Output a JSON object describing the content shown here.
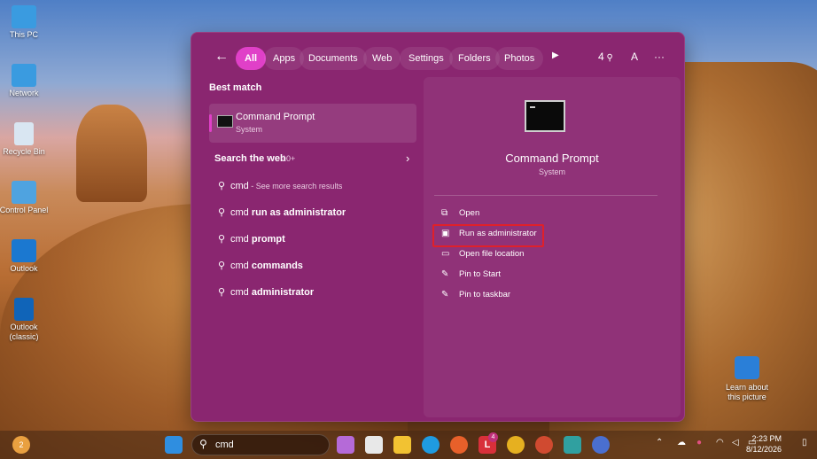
{
  "desktop": {
    "icons": [
      {
        "label": "This PC"
      },
      {
        "label": "Network"
      },
      {
        "label": "Recycle Bin"
      },
      {
        "label": "Control Panel"
      },
      {
        "label": "Outlook"
      },
      {
        "label": "Outlook (classic)"
      }
    ],
    "learn_label": "Learn about this picture"
  },
  "panel": {
    "back_glyph": "←",
    "filters": [
      "All",
      "Apps",
      "Documents",
      "Web",
      "Settings",
      "Folders",
      "Photos"
    ],
    "active_filter": "All",
    "play_glyph": "▶",
    "rewards_count": "4",
    "account_letter": "A",
    "more_glyph": "···",
    "best_match": {
      "section_title": "Best match",
      "title": "Command Prompt",
      "subtitle": "System"
    },
    "web": {
      "section_title": "Search the web",
      "count": "10+",
      "chevron": "›",
      "results": [
        {
          "prefix": "cmd",
          "bold": "",
          "sub": " - See more search results"
        },
        {
          "prefix": "cmd ",
          "bold": "run as administrator",
          "sub": ""
        },
        {
          "prefix": "cmd ",
          "bold": "prompt",
          "sub": ""
        },
        {
          "prefix": "cmd ",
          "bold": "commands",
          "sub": ""
        },
        {
          "prefix": "cmd ",
          "bold": "administrator",
          "sub": ""
        }
      ]
    },
    "detail": {
      "title": "Command Prompt",
      "subtitle": "System",
      "actions": [
        {
          "label": "Open",
          "icon": "open-icon"
        },
        {
          "label": "Run as administrator",
          "icon": "shield-icon"
        },
        {
          "label": "Open file location",
          "icon": "folder-icon"
        },
        {
          "label": "Pin to Start",
          "icon": "pin-icon"
        },
        {
          "label": "Pin to taskbar",
          "icon": "pin-icon"
        }
      ]
    }
  },
  "taskbar": {
    "search_value": "cmd",
    "widget_badge": "2",
    "time": "2:23 PM",
    "date": "8/12/2026",
    "badge_l": "4"
  },
  "colors": {
    "panel": "#8a2670",
    "accent": "#e040c8",
    "highlight": "#e0202a"
  }
}
